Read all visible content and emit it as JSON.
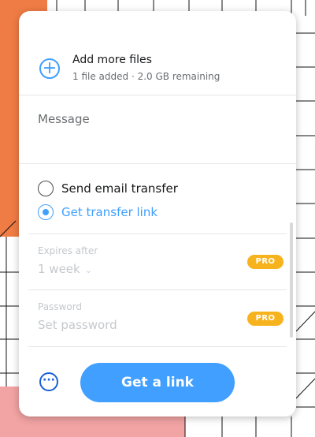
{
  "add_files": {
    "title": "Add more files",
    "subtitle": "1 file added · 2.0 GB remaining",
    "icon": "plus-circle-icon"
  },
  "message": {
    "label": "Message"
  },
  "transfer_type": {
    "options": [
      {
        "label": "Send email transfer",
        "selected": false
      },
      {
        "label": "Get transfer link",
        "selected": true
      }
    ]
  },
  "expires": {
    "label": "Expires after",
    "value": "1 week",
    "badge": "PRO"
  },
  "password": {
    "label": "Password",
    "placeholder": "Set password",
    "badge": "PRO"
  },
  "actions": {
    "more_icon": "ellipsis-circle-icon",
    "primary_label": "Get a link"
  },
  "colors": {
    "accent": "#409fff",
    "pro_badge": "#f7b31e",
    "background_orange": "#f07c45",
    "background_pink": "#f2a3a3"
  }
}
